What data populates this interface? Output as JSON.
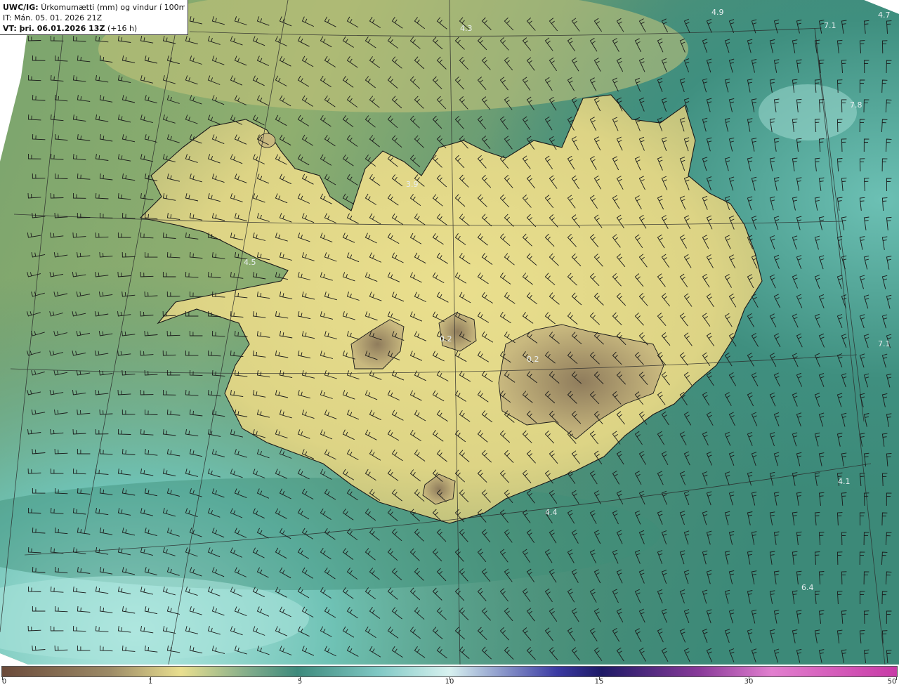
{
  "header": {
    "product": "UWC/IG:",
    "description": "Úrkomumætti (mm) og vindur í 100m hæð",
    "it_label": "IT:",
    "it_value": "Mán. 05. 01. 2026 21Z",
    "vt_label": "VT: þri. 06.01.2026 13Z",
    "vt_lead": "(+16 h)"
  },
  "colorbar": {
    "ticks": [
      {
        "label": "0",
        "value": 0
      },
      {
        "label": "1",
        "value": 1
      },
      {
        "label": "5",
        "value": 5
      },
      {
        "label": "10",
        "value": 10
      },
      {
        "label": "15",
        "value": 15
      },
      {
        "label": "30",
        "value": 30
      },
      {
        "label": "50",
        "value": 50
      }
    ],
    "colors": [
      "#6b4a3a",
      "#9c8a66",
      "#e9df8f",
      "#7ba98a",
      "#3d8a7c",
      "#7fc8c4",
      "#d8f2f0",
      "#3b3aa3",
      "#1d1966",
      "#8a3a9a",
      "#e27fcf",
      "#c83aa6"
    ]
  },
  "value_labels": [
    {
      "text": "4.9"
    },
    {
      "text": "4.7"
    },
    {
      "text": "7.1"
    },
    {
      "text": "4.3"
    },
    {
      "text": "7.8"
    },
    {
      "text": "3.9"
    },
    {
      "text": "4.5"
    },
    {
      "text": "0.2"
    },
    {
      "text": "0.2"
    },
    {
      "text": "7.1"
    },
    {
      "text": "4.1"
    },
    {
      "text": "4.4"
    },
    {
      "text": "6.4"
    }
  ],
  "colors": {
    "land_low": "#e9df8f",
    "land_mid": "#c9c27c",
    "glacier": "#9c8a66",
    "sea_green": "#4d8f74",
    "sea_teal": "#5fb3a6",
    "sea_light": "#aee3dc"
  }
}
